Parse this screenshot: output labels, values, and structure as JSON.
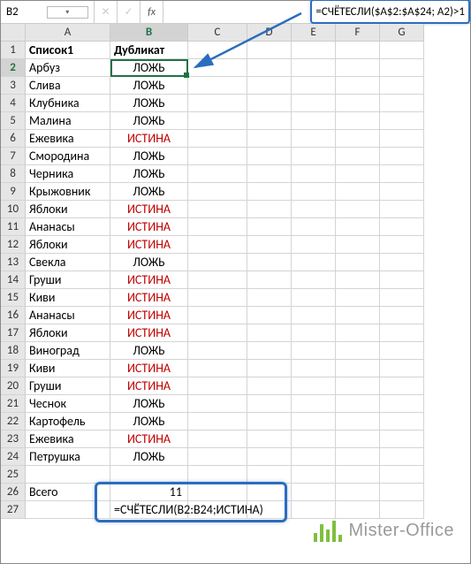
{
  "namebox": "B2",
  "formula": "=СЧЁТЕСЛИ($A$2:$A$24; A2)>1",
  "columns": [
    "A",
    "B",
    "C",
    "D",
    "E",
    "F",
    "G"
  ],
  "headers": {
    "A": "Список1",
    "B": "Дубликат"
  },
  "rows": [
    {
      "n": 2,
      "a": "Арбуз",
      "b": "ЛОЖЬ",
      "d": false
    },
    {
      "n": 3,
      "a": "Слива",
      "b": "ЛОЖЬ",
      "d": false
    },
    {
      "n": 4,
      "a": "Клубника",
      "b": "ЛОЖЬ",
      "d": false
    },
    {
      "n": 5,
      "a": "Малина",
      "b": "ЛОЖЬ",
      "d": false
    },
    {
      "n": 6,
      "a": "Ежевика",
      "b": "ИСТИНА",
      "d": true
    },
    {
      "n": 7,
      "a": "Смородина",
      "b": "ЛОЖЬ",
      "d": false
    },
    {
      "n": 8,
      "a": "Черника",
      "b": "ЛОЖЬ",
      "d": false
    },
    {
      "n": 9,
      "a": "Крыжовник",
      "b": "ЛОЖЬ",
      "d": false
    },
    {
      "n": 10,
      "a": "Яблоки",
      "b": "ИСТИНА",
      "d": true
    },
    {
      "n": 11,
      "a": "Ананасы",
      "b": "ИСТИНА",
      "d": true
    },
    {
      "n": 12,
      "a": "Яблоки",
      "b": "ИСТИНА",
      "d": true
    },
    {
      "n": 13,
      "a": "Свекла",
      "b": "ЛОЖЬ",
      "d": false
    },
    {
      "n": 14,
      "a": "Груши",
      "b": "ИСТИНА",
      "d": true
    },
    {
      "n": 15,
      "a": "Киви",
      "b": "ИСТИНА",
      "d": true
    },
    {
      "n": 16,
      "a": "Ананасы",
      "b": "ИСТИНА",
      "d": true
    },
    {
      "n": 17,
      "a": "Яблоки",
      "b": "ИСТИНА",
      "d": true
    },
    {
      "n": 18,
      "a": "Виноград",
      "b": "ЛОЖЬ",
      "d": false
    },
    {
      "n": 19,
      "a": "Киви",
      "b": "ИСТИНА",
      "d": true
    },
    {
      "n": 20,
      "a": "Груши",
      "b": "ИСТИНА",
      "d": true
    },
    {
      "n": 21,
      "a": "Чеснок",
      "b": "ЛОЖЬ",
      "d": false
    },
    {
      "n": 22,
      "a": "Картофель",
      "b": "ЛОЖЬ",
      "d": false
    },
    {
      "n": 23,
      "a": "Ежевика",
      "b": "ИСТИНА",
      "d": true
    },
    {
      "n": 24,
      "a": "Петрушка",
      "b": "ЛОЖЬ",
      "d": false
    }
  ],
  "summary": {
    "label": "Всего",
    "value": "11",
    "formula": "=СЧЁТЕСЛИ(B2:B24;ИСТИНА)"
  },
  "watermark": "Mister-Office"
}
